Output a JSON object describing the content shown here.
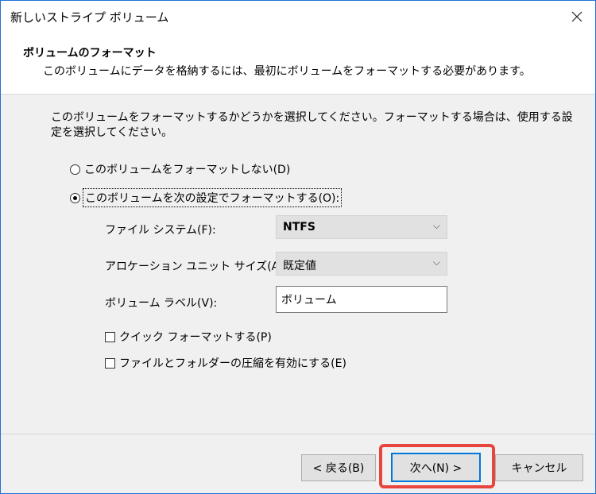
{
  "window": {
    "title": "新しいストライプ ボリューム"
  },
  "header": {
    "title": "ボリュームのフォーマット",
    "subtitle": "このボリュームにデータを格納するには、最初にボリュームをフォーマットする必要があります。"
  },
  "intro": "このボリュームをフォーマットするかどうかを選択してください。フォーマットする場合は、使用する設定を選択してください。",
  "options": {
    "no_format": {
      "label": "このボリュームをフォーマットしない(D)",
      "selected": false
    },
    "format": {
      "label": "このボリュームを次の設定でフォーマットする(O):",
      "selected": true
    }
  },
  "fields": {
    "filesystem": {
      "label": "ファイル システム(F):",
      "value": "NTFS"
    },
    "allocation": {
      "label": "アロケーション ユニット サイズ(A):",
      "value": "既定値"
    },
    "volume_label": {
      "label": "ボリューム ラベル(V):",
      "value": "ボリューム"
    }
  },
  "checkboxes": {
    "quick_format": {
      "label": "クイック フォーマットする(P)",
      "checked": false
    },
    "compression": {
      "label": "ファイルとフォルダーの圧縮を有効にする(E)",
      "checked": false
    }
  },
  "buttons": {
    "back": "< 戻る(B)",
    "next": "次へ(N) >",
    "cancel": "キャンセル"
  },
  "colors": {
    "accent": "#0078d7",
    "highlight": "#e8453f"
  },
  "icons": {
    "close": "close-icon",
    "dropdown": "chevron-down-icon"
  }
}
